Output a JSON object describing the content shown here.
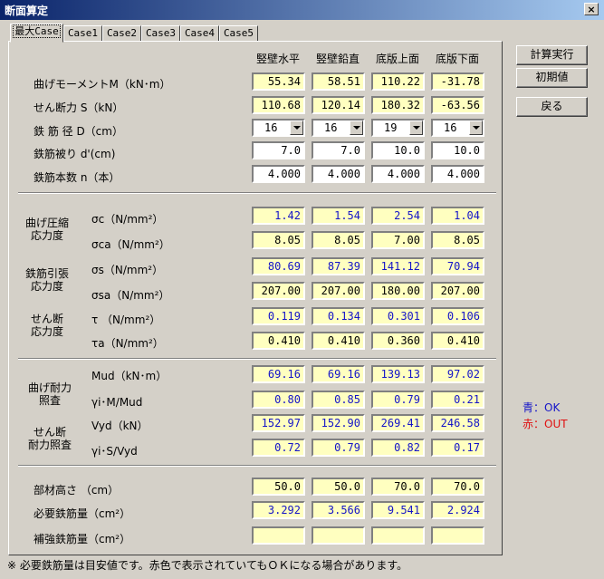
{
  "window": {
    "title": "断面算定",
    "close": "×"
  },
  "tabs": [
    "最大Case",
    "Case1",
    "Case2",
    "Case3",
    "Case4",
    "Case5"
  ],
  "columns": [
    "竪壁水平",
    "竪壁鉛直",
    "底版上面",
    "底版下面"
  ],
  "section1": {
    "rows": [
      {
        "label": "曲げモーメントM（kN･m）",
        "values": [
          "55.34",
          "58.51",
          "110.22",
          "-31.78"
        ]
      },
      {
        "label": "せん断力 S（kN）",
        "values": [
          "110.68",
          "120.14",
          "180.32",
          "-63.56"
        ]
      },
      {
        "label": "鉄 筋 径 D（cm）",
        "values": [
          "16",
          "16",
          "19",
          "16"
        ]
      },
      {
        "label": "鉄筋被り d'(cm)",
        "values": [
          "7.0",
          "7.0",
          "10.0",
          "10.0"
        ]
      },
      {
        "label": "鉄筋本数 n（本）",
        "values": [
          "4.000",
          "4.000",
          "4.000",
          "4.000"
        ]
      }
    ]
  },
  "section2": {
    "groups": [
      {
        "label1": "曲げ圧縮",
        "label2": "応力度"
      },
      {
        "label1": "鉄筋引張",
        "label2": "応力度"
      },
      {
        "label1": "せん断",
        "label2": "応力度"
      }
    ],
    "rows": [
      {
        "label": "σc（N/mm²）",
        "values": [
          "1.42",
          "1.54",
          "2.54",
          "1.04"
        ]
      },
      {
        "label": "σca（N/mm²）",
        "values": [
          "8.05",
          "8.05",
          "7.00",
          "8.05"
        ]
      },
      {
        "label": "σs（N/mm²）",
        "values": [
          "80.69",
          "87.39",
          "141.12",
          "70.94"
        ]
      },
      {
        "label": "σsa（N/mm²）",
        "values": [
          "207.00",
          "207.00",
          "180.00",
          "207.00"
        ]
      },
      {
        "label": "τ （N/mm²）",
        "values": [
          "0.119",
          "0.134",
          "0.301",
          "0.106"
        ]
      },
      {
        "label": "τa（N/mm²）",
        "values": [
          "0.410",
          "0.410",
          "0.360",
          "0.410"
        ]
      }
    ]
  },
  "section3": {
    "groups": [
      {
        "label1": "曲げ耐力",
        "label2": "照査"
      },
      {
        "label1": "せん断",
        "label2": "耐力照査"
      }
    ],
    "rows": [
      {
        "label": "Mud（kN･m）",
        "values": [
          "69.16",
          "69.16",
          "139.13",
          "97.02"
        ]
      },
      {
        "label": "γi･M/Mud",
        "values": [
          "0.80",
          "0.85",
          "0.79",
          "0.21"
        ]
      },
      {
        "label": "Vyd（kN）",
        "values": [
          "152.97",
          "152.90",
          "269.41",
          "246.58"
        ]
      },
      {
        "label": "γi･S/Vyd",
        "values": [
          "0.72",
          "0.79",
          "0.82",
          "0.17"
        ]
      }
    ]
  },
  "section4": {
    "rows": [
      {
        "label": "部材高さ （cm）",
        "values": [
          "50.0",
          "50.0",
          "70.0",
          "70.0"
        ]
      },
      {
        "label": "必要鉄筋量（cm²）",
        "values": [
          "3.292",
          "3.566",
          "9.541",
          "2.924"
        ]
      },
      {
        "label": "補強鉄筋量（cm²）",
        "values": [
          "",
          "",
          "",
          ""
        ]
      }
    ]
  },
  "buttons": {
    "calc": "計算実行",
    "init": "初期値",
    "back": "戻る"
  },
  "legend": {
    "ok": "青：OK",
    "out": "赤：OUT",
    "ok_color": "#1414c8",
    "out_color": "#e01010"
  },
  "note": "※ 必要鉄筋量は目安値です。赤色で表示されていてもＯＫになる場合があります。"
}
